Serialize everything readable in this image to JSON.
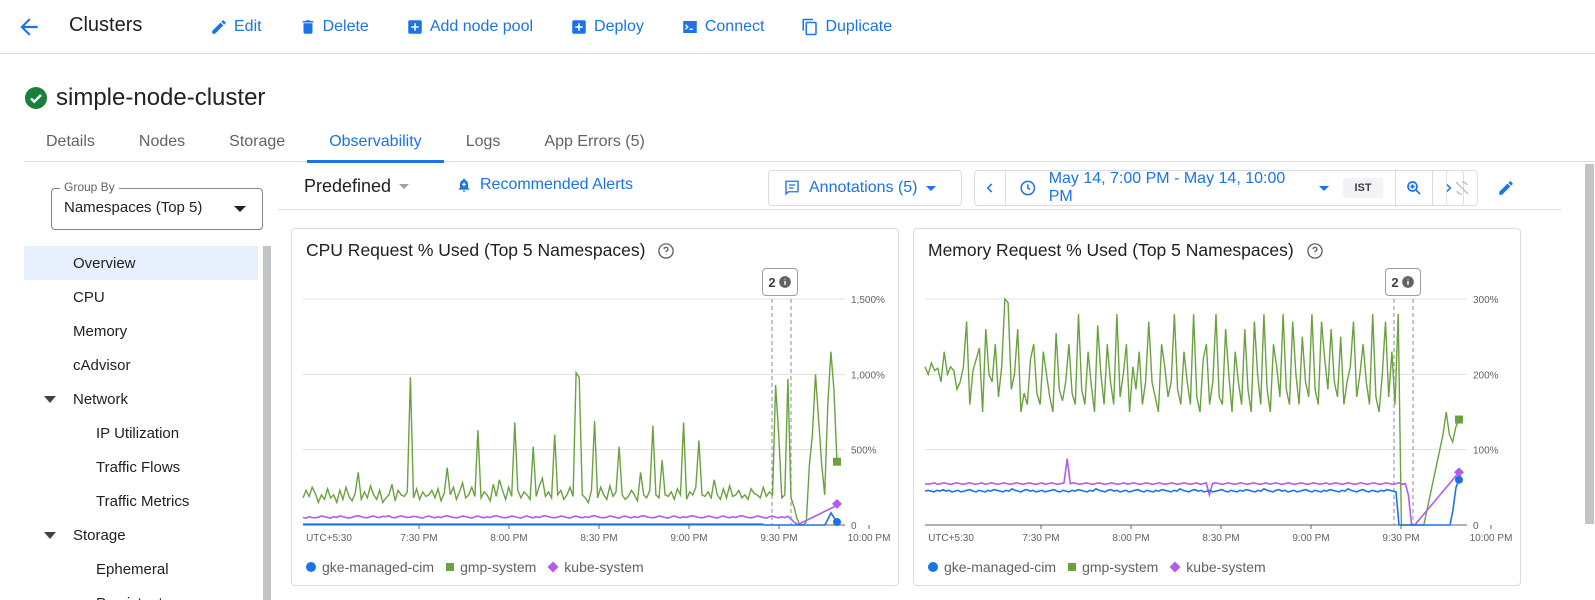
{
  "toolbar": {
    "title": "Clusters",
    "actions": [
      {
        "label": "Edit",
        "icon": "pencil-icon"
      },
      {
        "label": "Delete",
        "icon": "trash-icon"
      },
      {
        "label": "Add node pool",
        "icon": "add-box-icon"
      },
      {
        "label": "Deploy",
        "icon": "add-box-icon"
      },
      {
        "label": "Connect",
        "icon": "terminal-icon"
      },
      {
        "label": "Duplicate",
        "icon": "copy-icon"
      }
    ]
  },
  "cluster": {
    "name": "simple-node-cluster",
    "status": "ok"
  },
  "tabs": [
    "Details",
    "Nodes",
    "Storage",
    "Observability",
    "Logs",
    "App Errors (5)"
  ],
  "active_tab": "Observability",
  "sidebar": {
    "group_by_label": "Group By",
    "group_by_value": "Namespaces (Top 5)",
    "items": [
      "Overview",
      "CPU",
      "Memory",
      "cAdvisor",
      "Network",
      "IP Utilization",
      "Traffic Flows",
      "Traffic Metrics",
      "Storage",
      "Ephemeral",
      "Persistent"
    ]
  },
  "controls": {
    "predefined": "Predefined",
    "recommended_alerts": "Recommended Alerts",
    "annotations": "Annotations (5)",
    "time_range": "May 14, 7:00 PM - May 14, 10:00 PM",
    "timezone": "IST"
  },
  "colors": {
    "accent": "#1a73e8",
    "gke": "#1a73e8",
    "gmp": "#6aa23f",
    "kube": "#b05cf0"
  },
  "chart_data": [
    {
      "type": "line",
      "title": "CPU Request % Used (Top 5 Namespaces)",
      "x_labels": [
        "UTC+5:30",
        "7:30 PM",
        "8:00 PM",
        "8:30 PM",
        "9:00 PM",
        "9:30 PM",
        "10:00 PM"
      ],
      "y_ticks": [
        "0",
        "500%",
        "1,000%",
        "1,500%"
      ],
      "ylim": [
        0,
        1500
      ],
      "annotation_count": "2",
      "series": [
        {
          "name": "gke-managed-cim",
          "values": [
            5,
            5,
            5,
            5,
            5,
            5,
            5,
            5,
            5,
            5,
            5,
            5,
            5,
            5,
            5,
            5,
            5,
            5,
            5,
            5,
            5,
            5,
            5,
            5,
            5,
            5,
            5,
            5,
            5,
            5,
            5,
            5,
            5,
            5,
            5,
            5,
            5,
            5,
            5,
            5,
            5,
            5,
            5,
            5,
            5,
            5,
            5,
            5,
            5,
            5,
            5,
            5,
            5,
            5,
            5,
            5,
            5,
            5,
            5,
            5,
            5,
            5,
            5,
            5,
            5,
            5,
            5,
            5,
            5,
            5,
            5,
            5,
            5,
            5,
            5,
            5,
            5,
            5,
            5,
            5,
            5,
            5,
            5,
            5,
            5,
            5,
            5,
            5,
            5,
            5,
            5,
            5,
            5,
            5,
            5,
            5,
            5,
            5,
            5,
            5,
            5,
            5,
            5,
            5,
            5,
            5,
            5,
            5,
            5,
            5,
            5,
            5,
            5,
            5,
            5,
            5,
            5,
            5,
            5,
            5,
            5,
            5,
            5,
            5,
            5,
            5,
            5,
            5,
            5,
            5,
            5,
            5,
            5,
            5,
            5,
            5,
            5,
            5,
            5,
            5,
            5,
            5,
            5,
            5,
            5,
            5,
            5,
            5,
            5,
            5,
            5,
            5,
            5,
            5,
            0,
            0,
            0,
            0,
            0,
            0,
            0,
            0,
            0,
            0,
            0,
            0,
            0,
            0,
            0,
            0,
            0,
            0,
            0,
            0,
            0,
            40,
            80,
            50,
            20
          ]
        },
        {
          "name": "gmp-system",
          "values": [
            180,
            230,
            190,
            250,
            210,
            150,
            200,
            170,
            240,
            180,
            200,
            150,
            230,
            170,
            250,
            190,
            160,
            210,
            350,
            170,
            220,
            180,
            260,
            200,
            170,
            230,
            150,
            180,
            200,
            270,
            160,
            230,
            200,
            190,
            220,
            980,
            180,
            240,
            170,
            220,
            190,
            200,
            230,
            180,
            240,
            160,
            210,
            380,
            200,
            250,
            170,
            220,
            280,
            180,
            200,
            250,
            190,
            630,
            180,
            220,
            200,
            160,
            270,
            190,
            300,
            230,
            170,
            250,
            190,
            680,
            230,
            180,
            220,
            200,
            170,
            520,
            190,
            260,
            310,
            190,
            220,
            180,
            600,
            200,
            230,
            170,
            200,
            250,
            190,
            1010,
            980,
            200,
            180,
            150,
            230,
            690,
            180,
            250,
            200,
            170,
            260,
            190,
            220,
            520,
            200,
            170,
            190,
            230,
            200,
            160,
            350,
            200,
            180,
            230,
            660,
            200,
            180,
            430,
            200,
            190,
            220,
            170,
            240,
            200,
            680,
            170,
            220,
            200,
            250,
            560,
            200,
            190,
            220,
            180,
            300,
            200,
            170,
            240,
            180,
            260,
            190,
            200,
            230,
            180,
            200,
            170,
            240,
            210,
            200,
            180,
            250,
            190,
            220,
            200,
            930,
            600,
            180,
            200,
            970,
            180,
            120,
            40,
            0,
            0,
            20,
            400,
            600,
            1000,
            700,
            400,
            200,
            800,
            1150,
            900,
            420
          ]
        },
        {
          "name": "kube-system",
          "values": [
            50,
            45,
            55,
            50,
            48,
            52,
            60,
            55,
            50,
            45,
            55,
            50,
            60,
            55,
            50,
            45,
            52,
            58,
            62,
            55,
            50,
            48,
            55,
            60,
            52,
            50,
            58,
            55,
            62,
            50,
            48,
            55,
            60,
            55,
            50,
            52,
            58,
            55,
            50,
            45,
            55,
            60,
            52,
            48,
            55,
            50,
            58,
            62,
            55,
            50,
            48,
            52,
            60,
            55,
            50,
            45,
            55,
            60,
            52,
            48,
            55,
            50,
            58,
            62,
            55,
            50,
            48,
            52,
            60,
            55,
            50,
            45,
            55,
            60,
            52,
            48,
            55,
            50,
            58,
            62,
            55,
            50,
            48,
            52,
            60,
            55,
            50,
            45,
            55,
            60,
            52,
            48,
            55,
            50,
            58,
            62,
            55,
            50,
            48,
            52,
            60,
            55,
            50,
            45,
            55,
            60,
            52,
            48,
            55,
            50,
            58,
            62,
            55,
            50,
            48,
            52,
            60,
            55,
            50,
            45,
            55,
            60,
            52,
            48,
            55,
            50,
            58,
            62,
            55,
            50,
            48,
            52,
            60,
            55,
            50,
            45,
            55,
            60,
            52,
            48,
            55,
            50,
            58,
            62,
            55,
            50,
            48,
            52,
            60,
            55,
            50,
            45,
            55,
            60,
            52,
            48,
            55,
            50,
            58,
            40,
            20,
            5,
            10,
            20,
            30,
            40,
            50,
            60,
            70,
            80,
            90,
            100,
            110,
            120,
            140
          ]
        }
      ]
    },
    {
      "type": "line",
      "title": "Memory Request % Used (Top 5 Namespaces)",
      "x_labels": [
        "UTC+5:30",
        "7:30 PM",
        "8:00 PM",
        "8:30 PM",
        "9:00 PM",
        "9:30 PM",
        "10:00 PM"
      ],
      "y_ticks": [
        "0",
        "100%",
        "200%",
        "300%"
      ],
      "ylim": [
        0,
        300
      ],
      "annotation_count": "2",
      "series": [
        {
          "name": "gke-managed-cim",
          "values": [
            45,
            46,
            45,
            44,
            46,
            45,
            47,
            45,
            46,
            44,
            45,
            46,
            44,
            45,
            46,
            47,
            45,
            44,
            46,
            45,
            44,
            46,
            45,
            47,
            46,
            45,
            44,
            46,
            45,
            48,
            46,
            45,
            44,
            46,
            47,
            45,
            46,
            44,
            45,
            46,
            44,
            45,
            46,
            47,
            45,
            44,
            46,
            45,
            44,
            46,
            45,
            47,
            46,
            45,
            44,
            46,
            45,
            48,
            46,
            45,
            44,
            46,
            47,
            45,
            46,
            44,
            45,
            46,
            44,
            45,
            46,
            47,
            45,
            44,
            46,
            45,
            44,
            46,
            45,
            47,
            46,
            45,
            44,
            46,
            45,
            48,
            46,
            45,
            44,
            46,
            47,
            45,
            46,
            44,
            45,
            46,
            44,
            45,
            46,
            47,
            45,
            44,
            46,
            45,
            44,
            46,
            45,
            47,
            46,
            45,
            44,
            46,
            45,
            48,
            46,
            45,
            44,
            46,
            47,
            45,
            46,
            44,
            45,
            46,
            44,
            45,
            46,
            47,
            45,
            44,
            46,
            45,
            44,
            46,
            45,
            47,
            46,
            45,
            44,
            46,
            45,
            48,
            46,
            45,
            44,
            46,
            47,
            45,
            44,
            46,
            45,
            44,
            46,
            45,
            47,
            46,
            45,
            44,
            0,
            0,
            0,
            0,
            0,
            0,
            0,
            0,
            0,
            0,
            0,
            0,
            0,
            0,
            0,
            0,
            0,
            0,
            20,
            50,
            60
          ]
        },
        {
          "name": "gmp-system",
          "values": [
            210,
            200,
            215,
            205,
            208,
            190,
            230,
            200,
            210,
            205,
            180,
            190,
            210,
            270,
            160,
            205,
            220,
            235,
            150,
            260,
            200,
            190,
            240,
            170,
            210,
            300,
            295,
            180,
            200,
            260,
            150,
            175,
            160,
            220,
            240,
            175,
            160,
            230,
            200,
            170,
            150,
            255,
            180,
            165,
            190,
            240,
            175,
            160,
            280,
            180,
            160,
            230,
            185,
            150,
            265,
            200,
            160,
            240,
            190,
            160,
            280,
            170,
            200,
            240,
            150,
            210,
            180,
            230,
            160,
            190,
            270,
            190,
            170,
            150,
            240,
            210,
            170,
            190,
            280,
            180,
            160,
            230,
            190,
            160,
            280,
            170,
            150,
            220,
            240,
            160,
            190,
            280,
            170,
            160,
            260,
            200,
            150,
            230,
            190,
            160,
            260,
            180,
            150,
            270,
            200,
            160,
            280,
            180,
            150,
            240,
            210,
            170,
            280,
            180,
            160,
            270,
            200,
            160,
            250,
            190,
            170,
            280,
            180,
            160,
            270,
            220,
            180,
            260,
            190,
            170,
            250,
            160,
            190,
            210,
            270,
            170,
            200,
            240,
            190,
            160,
            280,
            170,
            150,
            200,
            270,
            170,
            230,
            160,
            280,
            0,
            0,
            0,
            0,
            0,
            0,
            0,
            0,
            20,
            40,
            60,
            80,
            100,
            120,
            150,
            120,
            110,
            130,
            140
          ]
        },
        {
          "name": "kube-system",
          "values": [
            55,
            54,
            55,
            56,
            54,
            55,
            56,
            55,
            54,
            55,
            56,
            55,
            54,
            55,
            56,
            55,
            54,
            55,
            56,
            54,
            55,
            56,
            55,
            54,
            55,
            56,
            55,
            54,
            55,
            56,
            55,
            54,
            55,
            56,
            55,
            54,
            55,
            56,
            54,
            55,
            56,
            55,
            54,
            55,
            56,
            88,
            55,
            56,
            55,
            54,
            55,
            56,
            55,
            54,
            55,
            56,
            55,
            54,
            55,
            56,
            55,
            54,
            55,
            56,
            54,
            55,
            56,
            55,
            54,
            55,
            56,
            55,
            54,
            55,
            56,
            55,
            54,
            55,
            56,
            55,
            54,
            55,
            56,
            55,
            54,
            55,
            56,
            54,
            55,
            56,
            40,
            55,
            56,
            55,
            54,
            55,
            56,
            55,
            54,
            55,
            56,
            55,
            54,
            55,
            56,
            55,
            54,
            55,
            56,
            54,
            55,
            56,
            55,
            54,
            55,
            56,
            55,
            54,
            55,
            56,
            55,
            54,
            55,
            56,
            55,
            54,
            55,
            56,
            54,
            55,
            56,
            55,
            54,
            55,
            56,
            55,
            54,
            55,
            56,
            55,
            54,
            55,
            56,
            55,
            54,
            55,
            56,
            55,
            54,
            55,
            56,
            54,
            55,
            40,
            0,
            0,
            5,
            10,
            15,
            20,
            25,
            30,
            35,
            40,
            45,
            50,
            55,
            60,
            65,
            70
          ]
        }
      ]
    }
  ]
}
